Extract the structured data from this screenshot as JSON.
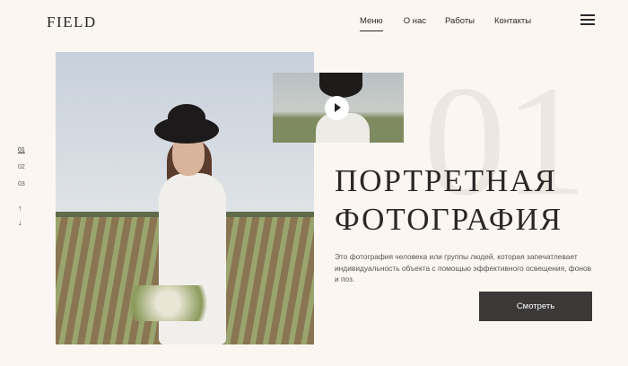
{
  "header": {
    "logo": "FIELD",
    "nav": [
      "Меню",
      "О нас",
      "Работы",
      "Контакты"
    ]
  },
  "pager": [
    "01",
    "02",
    "03"
  ],
  "arrows": {
    "up": "↑",
    "down": "↓"
  },
  "hero": {
    "bignum": "01",
    "title_line1": "ПОРТРЕТНАЯ",
    "title_line2": "ФОТОГРАФИЯ",
    "description": "Это фотография человека или группы людей, которая запечатлевает индивидуальность объекта с помощью эффективного освещения, фонов и поз.",
    "button": "Смотреть"
  }
}
